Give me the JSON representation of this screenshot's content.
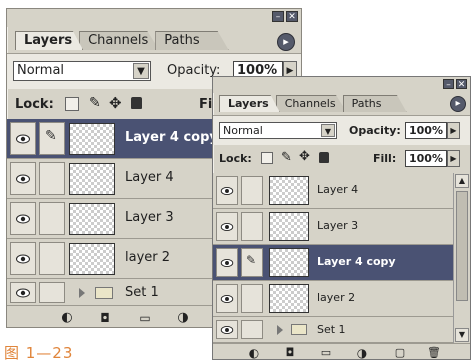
{
  "panel1": {
    "tabs": [
      "Layers",
      "Channels",
      "Paths"
    ],
    "blend_mode": "Normal",
    "opacity_label": "Opacity:",
    "opacity_value": "100%",
    "lock_label": "Lock:",
    "fill_label": "Fill",
    "layers": [
      {
        "name": "Layer 4 copy",
        "selected": true
      },
      {
        "name": "Layer 4",
        "selected": false
      },
      {
        "name": "Layer 3",
        "selected": false
      },
      {
        "name": "layer 2",
        "selected": false
      },
      {
        "name": "Set 1",
        "selected": false
      }
    ]
  },
  "panel2": {
    "tabs": [
      "Layers",
      "Channels",
      "Paths"
    ],
    "blend_mode": "Normal",
    "opacity_label": "Opacity:",
    "opacity_value": "100%",
    "lock_label": "Lock:",
    "fill_label": "Fill:",
    "fill_value": "100%",
    "layers": [
      {
        "name": "Layer 4",
        "selected": false
      },
      {
        "name": "Layer 3",
        "selected": false
      },
      {
        "name": "Layer 4 copy",
        "selected": true
      },
      {
        "name": "layer 2",
        "selected": false
      },
      {
        "name": "Set 1",
        "selected": false
      }
    ]
  },
  "caption": "图 1—23",
  "icons": {
    "visibility": "eye-icon",
    "brush": "brush-icon",
    "move": "move-icon",
    "lock": "lock-icon",
    "menu": "panel-menu-icon"
  },
  "colors": {
    "panel_bg": "#d6d3c8",
    "selected_row": "#4a5273",
    "caption": "#e0853b"
  }
}
